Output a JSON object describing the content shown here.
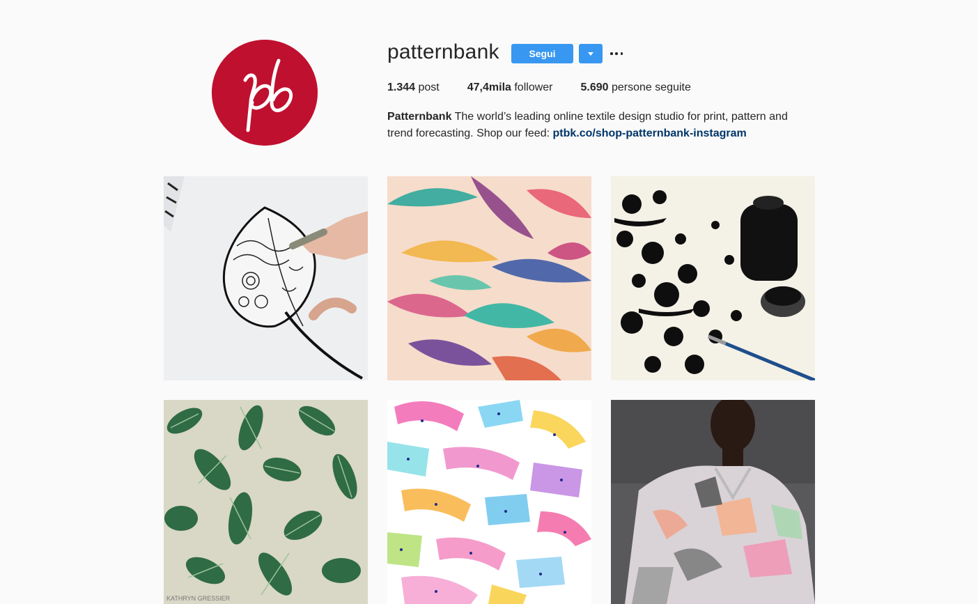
{
  "profile": {
    "username": "patternbank",
    "follow_label": "Segui",
    "stats": [
      {
        "value": "1.344",
        "label": "post"
      },
      {
        "value": "47,4mila",
        "label": "follower"
      },
      {
        "value": "5.690",
        "label": "persone seguite"
      }
    ],
    "bio": {
      "name": "Patternbank",
      "text": "The world’s leading online textile design studio for print, pattern and trend forecasting. Shop our feed:",
      "link": "ptbk.co/shop-patternbank-instagram"
    },
    "avatar_color": "#c0102f",
    "accent_color": "#3897f0",
    "link_color": "#003569"
  },
  "posts": [
    {
      "subject": "ink leaf drawing with pen"
    },
    {
      "subject": "watercolor leaves pattern"
    },
    {
      "subject": "black floral ink painting with ink bottle"
    },
    {
      "subject": "tropical leaves pattern",
      "signature": "KATHRYN GRESSIER"
    },
    {
      "subject": "colorful brush stroke pattern"
    },
    {
      "subject": "model wearing printed coat"
    }
  ]
}
